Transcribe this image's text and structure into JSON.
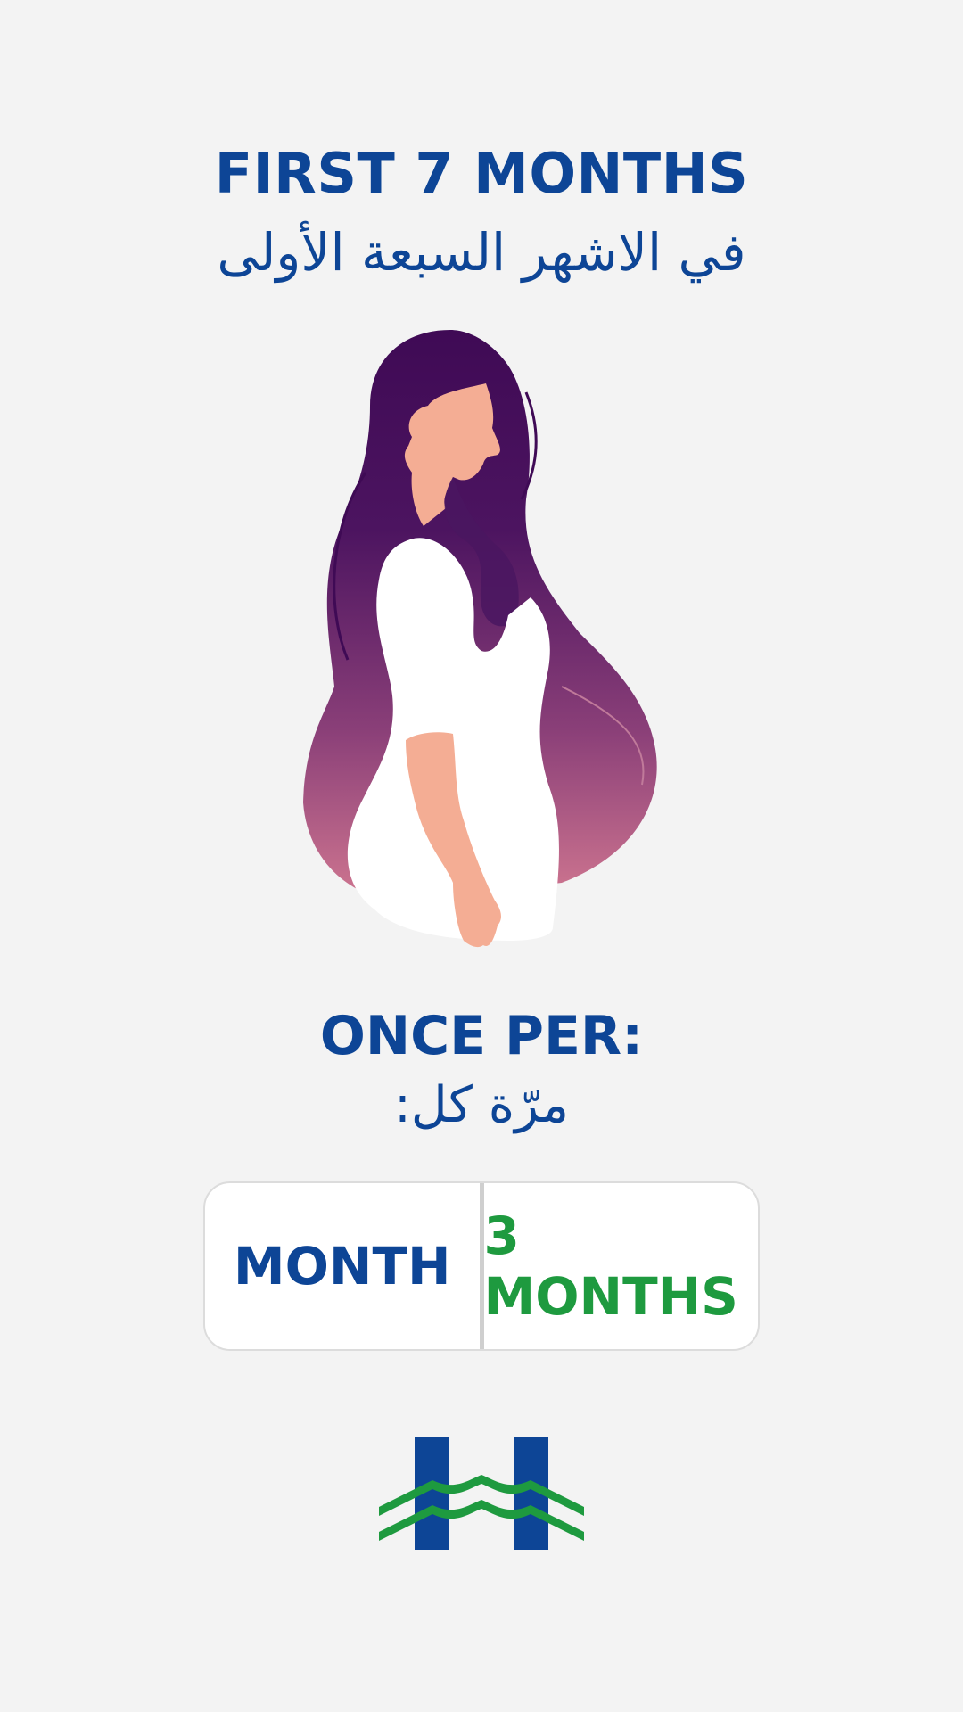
{
  "header": {
    "title_en": "FIRST 7 MONTHS",
    "title_ar": "في الاشهر السبعة الأولى"
  },
  "frequency": {
    "label_en": "ONCE PER:",
    "label_ar": "مرّة كل:"
  },
  "options": [
    {
      "label": "MONTH",
      "color": "#0d4596"
    },
    {
      "label": "3 MONTHS",
      "color": "#1e9a3f"
    }
  ],
  "colors": {
    "background": "#f3f3f3",
    "primary_blue": "#0d4596",
    "accent_green": "#1e9a3f",
    "hair_dark": "#3f0a55",
    "hair_light": "#c9708a",
    "skin": "#f4ad94"
  },
  "logo": {
    "icon": "hospital-h-logo-icon"
  },
  "illustration": {
    "icon": "pregnant-woman-illustration"
  }
}
